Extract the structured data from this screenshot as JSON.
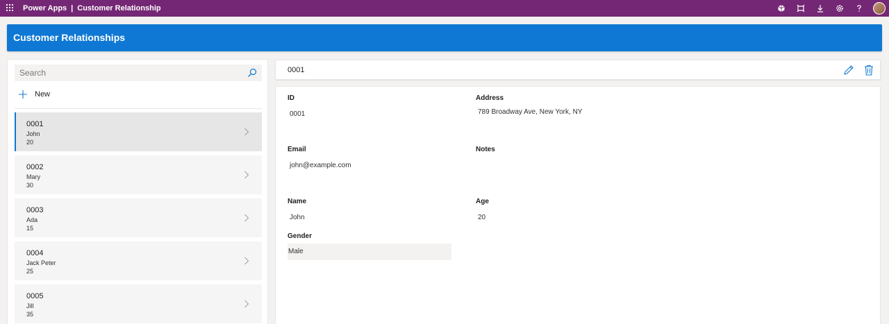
{
  "topbar": {
    "app_name": "Power Apps",
    "separator": "|",
    "page_name": "Customer Relationship",
    "bg_color": "#742774",
    "icons": [
      "waffle-icon",
      "environment-icon",
      "fullscreen-icon",
      "download-icon",
      "settings-icon",
      "help-icon"
    ]
  },
  "header": {
    "title": "Customer Relationships",
    "bg_color": "#0f78d4"
  },
  "left": {
    "search_placeholder": "Search",
    "new_label": "New",
    "items": [
      {
        "id": "0001",
        "name": "John",
        "age": "20",
        "selected": true
      },
      {
        "id": "0002",
        "name": "Mary",
        "age": "30",
        "selected": false
      },
      {
        "id": "0003",
        "name": "Ada",
        "age": "15",
        "selected": false
      },
      {
        "id": "0004",
        "name": "Jack Peter",
        "age": "25",
        "selected": false
      },
      {
        "id": "0005",
        "name": "Jill",
        "age": "35",
        "selected": false
      }
    ]
  },
  "detail": {
    "title": "0001",
    "fields": {
      "id_label": "ID",
      "id_value": "0001",
      "address_label": "Address",
      "address_value": "789 Broadway Ave, New York, NY",
      "email_label": "Email",
      "email_value": "john@example.com",
      "notes_label": "Notes",
      "notes_value": "",
      "name_label": "Name",
      "name_value": "John",
      "age_label": "Age",
      "age_value": "20",
      "gender_label": "Gender",
      "gender_value": "Male"
    }
  }
}
